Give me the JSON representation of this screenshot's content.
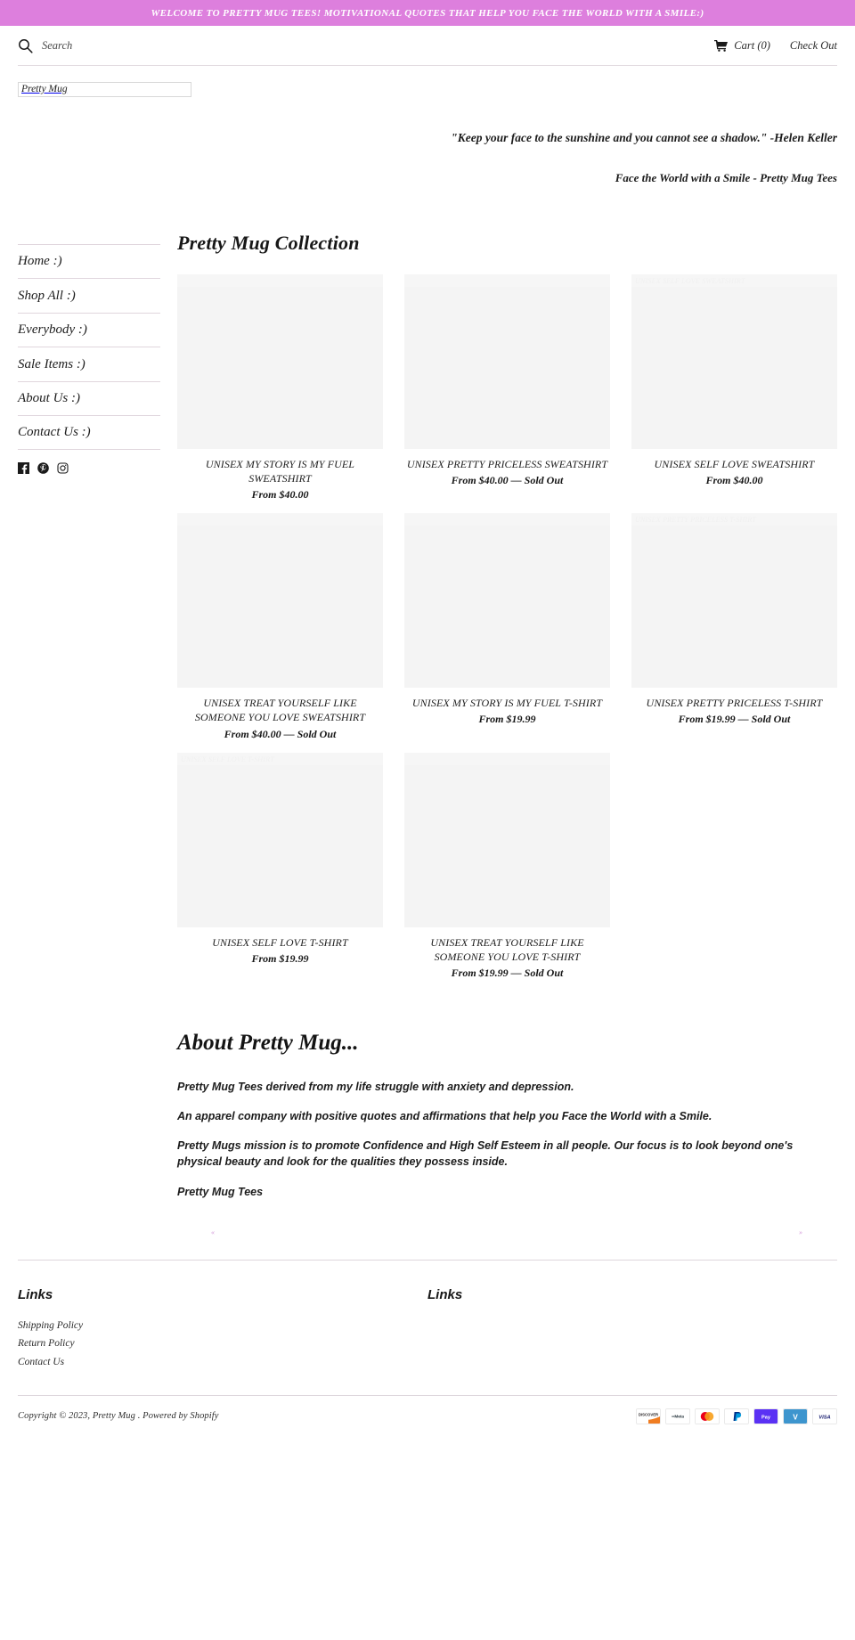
{
  "announcement": {
    "text": "WELCOME TO PRETTY MUG TEES! MOTIVATIONAL QUOTES THAT HELP YOU FACE THE WORLD WITH A SMILE:)",
    "background_color": "#dd7fdd",
    "text_color": "#ffffff"
  },
  "utility_bar": {
    "search_placeholder": "Search",
    "search_value": "",
    "search_icon": "search-icon",
    "cart_icon": "shopping-cart-icon",
    "cart_label": "Cart (0)",
    "checkout_label": "Check Out"
  },
  "logo": {
    "text": "Pretty Mug"
  },
  "hero": {
    "quote": "\"Keep your face to the sunshine and you cannot see a shadow.\" -Helen Keller",
    "tagline": "Face the World with a Smile - Pretty Mug Tees"
  },
  "sidebar": {
    "items": [
      {
        "label": "Home :)",
        "name": "sidebar-item-home"
      },
      {
        "label": "Shop All :)",
        "name": "sidebar-item-shop-all"
      },
      {
        "label": "Everybody :)",
        "name": "sidebar-item-everybody"
      },
      {
        "label": "Sale Items :)",
        "name": "sidebar-item-sale-items"
      },
      {
        "label": "About Us :)",
        "name": "sidebar-item-about-us"
      },
      {
        "label": "Contact Us :)",
        "name": "sidebar-item-contact-us"
      }
    ],
    "social": [
      {
        "name": "facebook-icon",
        "label": "Facebook"
      },
      {
        "name": "pinterest-icon",
        "label": "Pinterest"
      },
      {
        "name": "instagram-icon",
        "label": "Instagram"
      }
    ]
  },
  "collection": {
    "title": "Pretty Mug Collection",
    "products": [
      {
        "title": "UNISEX MY STORY IS MY FUEL SWEATSHIRT",
        "price": "From $40.00",
        "alt_ghost": ""
      },
      {
        "title": "UNISEX PRETTY PRICELESS SWEATSHIRT",
        "price": "From $40.00 — Sold Out",
        "alt_ghost": ""
      },
      {
        "title": "UNISEX SELF LOVE SWEATSHIRT",
        "price": "From $40.00",
        "alt_ghost": "UNISEX SELF LOVE SWEATSHIRT"
      },
      {
        "title": "UNISEX TREAT YOURSELF LIKE SOMEONE YOU LOVE SWEATSHIRT",
        "price": "From $40.00 — Sold Out",
        "alt_ghost": ""
      },
      {
        "title": "UNISEX MY STORY IS MY FUEL T-SHIRT",
        "price": "From $19.99",
        "alt_ghost": ""
      },
      {
        "title": "UNISEX PRETTY PRICELESS T-SHIRT",
        "price": "From $19.99 — Sold Out",
        "alt_ghost": "UNISEX PRETTY PRICELESS T-SHIRT"
      },
      {
        "title": "UNISEX SELF LOVE T-SHIRT",
        "price": "From $19.99",
        "alt_ghost": "UNISEX SELF LOVE T-SHIRT"
      },
      {
        "title": "UNISEX TREAT YOURSELF LIKE SOMEONE YOU LOVE T-SHIRT",
        "price": "From $19.99 — Sold Out",
        "alt_ghost": ""
      }
    ]
  },
  "about": {
    "title": "About Pretty Mug...",
    "paragraphs": [
      "Pretty Mug Tees derived from my life struggle with anxiety and depression.",
      "An apparel company with positive quotes and affirmations that help you Face the World with a Smile.",
      "Pretty Mugs mission is to promote Confidence and High Self Esteem in all people. Our focus is to look beyond one's physical beauty and look for the qualities they possess inside.",
      "Pretty Mug Tees"
    ]
  },
  "pagination": {
    "prev_label": "«",
    "next_label": "»",
    "color": "#cf8fd6"
  },
  "footer": {
    "columns": [
      {
        "heading": "Links",
        "links": [
          "Shipping Policy",
          "Return Policy",
          "Contact Us"
        ]
      },
      {
        "heading": "Links",
        "links": []
      }
    ],
    "copyright": "Copyright © 2023, Pretty Mug . Powered by Shopify",
    "payment_methods": [
      {
        "name": "discover-icon",
        "label": "DISCOVER"
      },
      {
        "name": "meta-pay-icon",
        "label": "Meta"
      },
      {
        "name": "mastercard-icon",
        "label": "Mastercard"
      },
      {
        "name": "paypal-icon",
        "label": "PayPal"
      },
      {
        "name": "shop-pay-icon",
        "label": "Pay"
      },
      {
        "name": "venmo-icon",
        "label": "V"
      },
      {
        "name": "visa-icon",
        "label": "VISA"
      }
    ]
  }
}
